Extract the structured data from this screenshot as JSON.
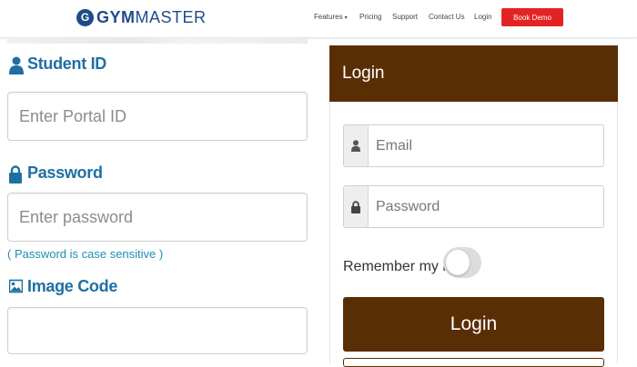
{
  "header": {
    "logo_bold": "GYM",
    "logo_light": "MASTER",
    "logo_mark": "G",
    "nav": {
      "features": "Features",
      "pricing": "Pricing",
      "support": "Support",
      "contact": "Contact Us",
      "login": "Login"
    },
    "cta": "Book Demo",
    "cta_color": "#e32323"
  },
  "form": {
    "student_id_label": "Student ID",
    "student_id_placeholder": "Enter Portal ID",
    "password_label": "Password",
    "password_placeholder": "Enter password",
    "password_hint": "( Password is case sensitive )",
    "image_code_label": "Image Code",
    "image_code_value": "",
    "label_color": "#1f6fa3",
    "icons": [
      "user-icon",
      "lock-icon",
      "image-icon"
    ]
  },
  "login_panel": {
    "title": "Login",
    "email_placeholder": "Email",
    "password_placeholder": "Password",
    "remember_label": "Remember my login",
    "remember_checked": false,
    "submit": "Login",
    "accent_color": "#5a2e05",
    "icons": [
      "user-icon",
      "lock-icon"
    ]
  }
}
